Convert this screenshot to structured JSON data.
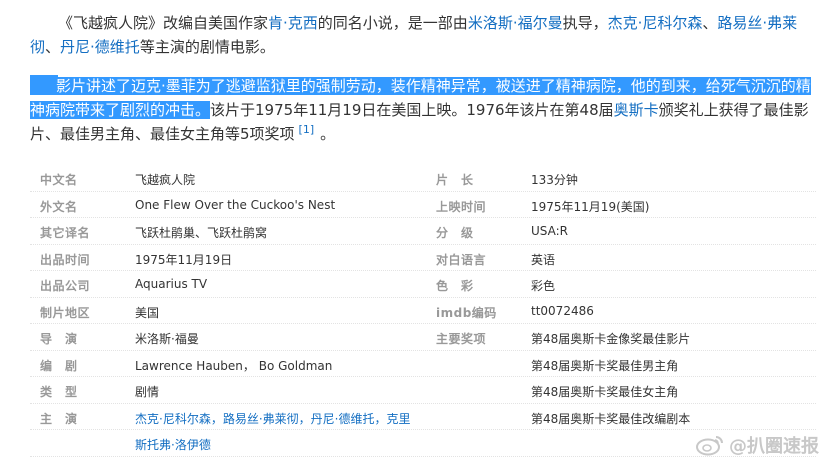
{
  "intro": {
    "p1_parts": [
      {
        "t": "《飞越疯人院》改编自美国作家",
        "link": false
      },
      {
        "t": "肯·克西",
        "link": true
      },
      {
        "t": "的同名小说，是一部由",
        "link": false
      },
      {
        "t": "米洛斯·福尔曼",
        "link": true
      },
      {
        "t": "执导，",
        "link": false
      },
      {
        "t": "杰克·尼科尔森",
        "link": true
      },
      {
        "t": "、",
        "link": false
      },
      {
        "t": "路易丝·弗莱彻",
        "link": true
      },
      {
        "t": "、",
        "link": false
      },
      {
        "t": "丹尼·德维托",
        "link": true
      },
      {
        "t": "等主演的剧情电影。",
        "link": false
      }
    ],
    "p2_highlight": "影片讲述了迈克·墨菲为了逃避监狱里的强制劳动，装作精神异常，被送进了精神病院，他的到来，给死气沉沉的精神病院带来了剧烈的冲击。",
    "p2_a": "该片于1975年11月19日在美国上映。1976年该片在第48届",
    "p2_link": "奥斯卡",
    "p2_b": "颁奖礼上获得了最佳影片、最佳男主角、最佳女主角等5项奖项",
    "ref": "[1]",
    "tail": "。"
  },
  "info": {
    "rows": [
      {
        "l1": "中文名",
        "v1": "飞越疯人院",
        "l2": "片　长",
        "v2": "133分钟"
      },
      {
        "l1": "外文名",
        "v1": "One Flew Over the Cuckoo's Nest",
        "l2": "上映时间",
        "v2": "1975年11月19(美国)"
      },
      {
        "l1": "其它译名",
        "v1": "飞跃杜鹃巢、飞跃杜鹃窝",
        "l2": "分　级",
        "v2": "USA:R"
      },
      {
        "l1": "出品时间",
        "v1": "1975年11月19日",
        "l2": "对白语言",
        "v2": "英语"
      },
      {
        "l1": "出品公司",
        "v1": "Aquarius TV",
        "l2": "色　彩",
        "v2": "彩色"
      },
      {
        "l1": "制片地区",
        "v1": "美国",
        "l2": "imdb编码",
        "v2": "tt0072486"
      },
      {
        "l1": "导　演",
        "v1": "米洛斯·福曼",
        "l2": "主要奖项",
        "v2": "第48届奥斯卡金像奖最佳影片"
      },
      {
        "l1": "编　剧",
        "v1": "Lawrence Hauben， Bo Goldman",
        "l2": "",
        "v2": "第48届奥斯卡奖最佳男主角"
      },
      {
        "l1": "类　型",
        "v1": "剧情",
        "l2": "",
        "v2": "第48届奥斯卡奖最佳女主角"
      },
      {
        "l1": "主　演",
        "v1": "杰克·尼科尔森，路易丝·弗莱彻，丹尼·德维托，克里",
        "l2": "",
        "v2": "第48届奥斯卡奖最佳改编剧本"
      },
      {
        "l1": "",
        "v1": "斯托弗·洛伊德",
        "l2": "",
        "v2": ""
      }
    ],
    "lead_links": [
      "杰克·尼科尔森",
      "路易丝·弗莱彻",
      "丹尼·德维托",
      "克里",
      "斯托弗·洛伊德"
    ]
  },
  "watermark": {
    "text": "@扒圈速报",
    "icon": "weibo-icon"
  }
}
